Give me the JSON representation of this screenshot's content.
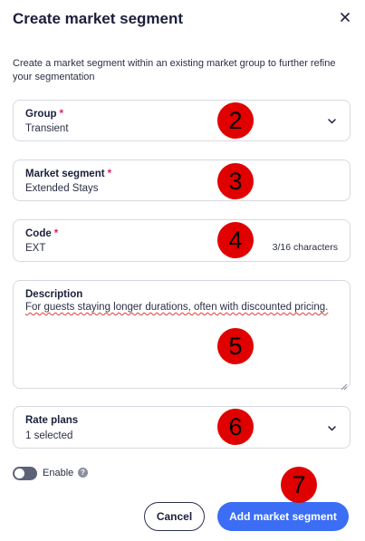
{
  "dialog": {
    "title": "Create market segment",
    "close_icon": "close-icon",
    "subtitle": "Create a market segment within an existing market group to further refine your segmentation"
  },
  "fields": {
    "group": {
      "label": "Group",
      "required_mark": "*",
      "value": "Transient"
    },
    "market_segment": {
      "label": "Market segment",
      "required_mark": "*",
      "value": "Extended Stays"
    },
    "code": {
      "label": "Code",
      "required_mark": "*",
      "value": "EXT",
      "counter": "3/16 characters"
    },
    "description": {
      "label": "Description",
      "value": "For guests staying longer durations, often with discounted pricing."
    },
    "rate_plans": {
      "label": "Rate plans",
      "value": "1 selected"
    }
  },
  "enable": {
    "label": "Enable",
    "checked": false,
    "help_icon": "help-icon"
  },
  "buttons": {
    "cancel": "Cancel",
    "primary": "Add market segment"
  },
  "annotations": [
    "2",
    "3",
    "4",
    "5",
    "6",
    "7"
  ],
  "colors": {
    "primary": "#3b6ef5",
    "required": "#e0245e",
    "badge": "#e00000",
    "toggle_off": "#5c6378"
  }
}
